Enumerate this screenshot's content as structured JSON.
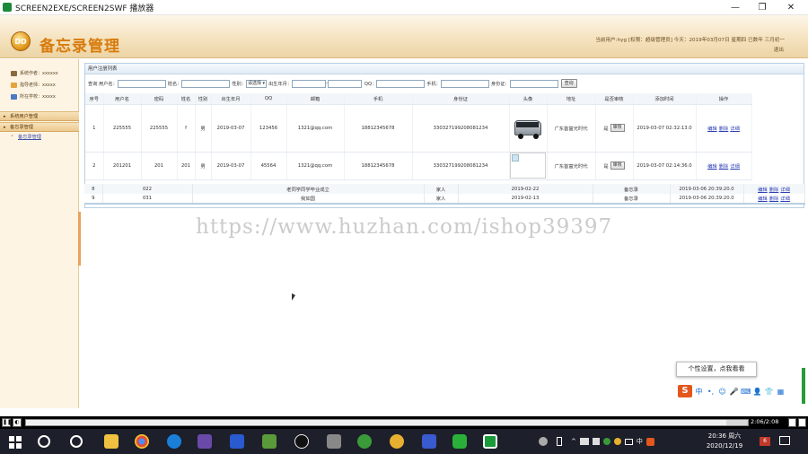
{
  "window": {
    "title": "SCREEN2EXE/SCREEN2SWF 播放器",
    "minimize_glyph": "—",
    "maximize_glyph": "❐",
    "close_glyph": "✕"
  },
  "header": {
    "app_title": "备忘录管理",
    "logo_text": "DD",
    "info": "当前用户:hyg [权限：超级管理员] 今天：2019年03月07日 星期四 已数年 三月初一",
    "logout": "退出"
  },
  "sidebar": {
    "user_lines": [
      {
        "label": "系统作者：xxxxxx",
        "icon_color": "#8a6a3c"
      },
      {
        "label": "指导老师：xxxxx",
        "icon_color": "#e3a53c"
      },
      {
        "label": "所在学校：xxxxx",
        "icon_color": "#4a7bc3"
      }
    ],
    "menus": [
      {
        "label": "系统用户管理"
      },
      {
        "label": "备忘录管理"
      }
    ],
    "sub_item": "备忘录管理"
  },
  "panel": {
    "title": "用户注册列表",
    "filters": {
      "query_label": "查询 用户名：",
      "name_label": "姓名：",
      "gender_label": "性别：",
      "gender_value": "请选择",
      "birth_label": "出生年月：",
      "range_sep": "-",
      "qq_label": "QQ：",
      "phone_label": "手机：",
      "id_label": "身份证：",
      "search_button": "查询"
    },
    "columns": [
      "序号",
      "用户名",
      "密码",
      "姓名",
      "性别",
      "出生年月",
      "QQ",
      "邮箱",
      "手机",
      "身份证",
      "头像",
      "地址",
      "是否审核",
      "添加时间",
      "操作"
    ],
    "rows": [
      {
        "no": "1",
        "username": "225555",
        "password": "225555",
        "name": "f",
        "gender": "男",
        "birth": "2019-03-07",
        "qq": "123456",
        "email": "1321@qq.com",
        "phone": "18812345678",
        "id_card": "330327199208081234",
        "avatar": "bus",
        "address": "广东首富光时代",
        "audit": "是",
        "audit_button": "审核",
        "added": "2019-03-07 02:32:13.0",
        "ops": [
          "编辑",
          "删除",
          "详细"
        ]
      },
      {
        "no": "2",
        "username": "201201",
        "password": "201",
        "name": "201",
        "gender": "男",
        "birth": "2019-03-07",
        "qq": "45564",
        "email": "1321@qq.com",
        "phone": "18812345678",
        "id_card": "330327199208081234",
        "avatar": "broken",
        "address": "广东首富光时代",
        "audit": "是",
        "audit_button": "审核",
        "added": "2019-03-07 02:14:36.0",
        "ops": [
          "编辑",
          "删除",
          "详细"
        ]
      }
    ]
  },
  "memo_rows": [
    {
      "no": "8",
      "code": "022",
      "title": "老同学同学毕业成立",
      "relation": "家人",
      "date": "2019-02-22",
      "type": "备忘录",
      "added": "2019-03-06 20:39:20.0",
      "ops": [
        "编辑",
        "删除",
        "详细"
      ]
    },
    {
      "no": "9",
      "code": "031",
      "title": "我如国",
      "relation": "家人",
      "date": "2019-02-13",
      "type": "备忘录",
      "added": "2019-03-06 20:39:20.0",
      "ops": [
        "编辑",
        "删除",
        "详细"
      ]
    }
  ],
  "watermark": "https://www.huzhan.com/ishop39397",
  "ime": {
    "tooltip": "个性设置，点我看看",
    "logo": "S",
    "items": [
      "中",
      "•,",
      "☺",
      "🎤",
      "⌨",
      "👤",
      "👕",
      "▦"
    ]
  },
  "player": {
    "progress": 0.97,
    "time": "2:06/2:08",
    "pause_glyph": "❚❚",
    "left_glyph": "◐"
  },
  "taskbar": {
    "clock_time": "20:36 周六",
    "clock_date": "2020/12/19",
    "tray_text": "中",
    "notify_count": "6"
  }
}
